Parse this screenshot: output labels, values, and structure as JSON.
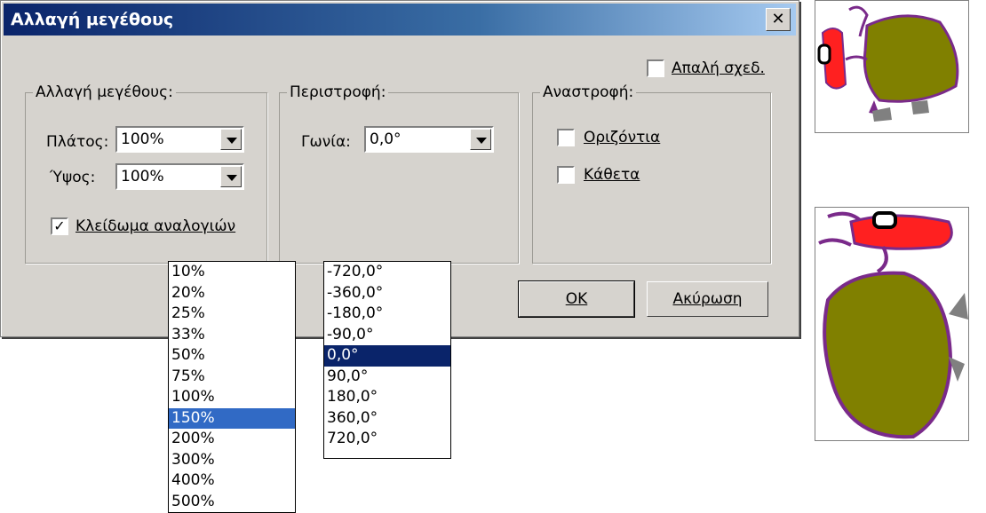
{
  "dialog": {
    "title": "Αλλαγή μεγέθους",
    "close_label": "✕",
    "smooth_label": "Απαλή σχεδ.",
    "smooth_checked": false,
    "resize_group": {
      "legend": "Αλλαγή μεγέθους:",
      "width_label": "Πλάτος:",
      "width_value": "100%",
      "height_label": "Ύψος:",
      "height_value": "100%",
      "lock_label": "Κλείδωμα αναλογιών",
      "lock_checked": true
    },
    "rotate_group": {
      "legend": "Περιστροφή:",
      "angle_label": "Γωνία:",
      "angle_value": "0,0°"
    },
    "flip_group": {
      "legend": "Αναστροφή:",
      "horizontal_label": "Οριζόντια",
      "vertical_label": "Κάθετα"
    },
    "ok_label": "OK",
    "cancel_label": "Ακύρωση",
    "check_mark": "✓"
  },
  "size_dropdown": {
    "options": [
      "10%",
      "20%",
      "25%",
      "33%",
      "50%",
      "75%",
      "100%",
      "150%",
      "200%",
      "300%",
      "400%",
      "500%"
    ],
    "selected": "150%",
    "selected_color": "#316ac5"
  },
  "angle_dropdown": {
    "options": [
      "-720,0°",
      "-360,0°",
      "-180,0°",
      "-90,0°",
      "0,0°",
      "90,0°",
      "180,0°",
      "360,0°",
      "720,0°"
    ],
    "selected": "0,0°",
    "selected_color": "#0a246a"
  },
  "colors": {
    "title_start": "#0a246a",
    "title_end": "#a6caf0",
    "face": "#d6d3ce"
  }
}
